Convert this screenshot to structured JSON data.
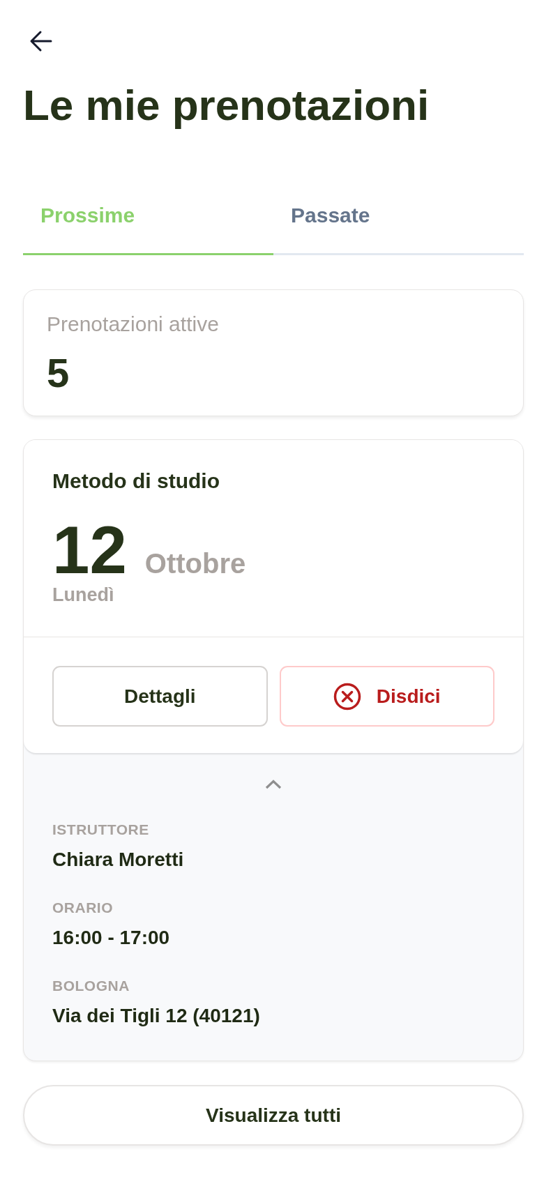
{
  "title": "Le mie prenotazioni",
  "tabs": [
    {
      "label": "Prossime",
      "selected": true
    },
    {
      "label": "Passate",
      "selected": false
    }
  ],
  "summary": {
    "label": "Prenotazioni attive",
    "value": "5"
  },
  "bookings": [
    {
      "course": "Metodo di studio",
      "day": "12",
      "month": "Ottobre",
      "weekday": "Lunedì",
      "actions": [
        {
          "label": "Dettagli",
          "kind": "details"
        },
        {
          "label": "Disdici",
          "kind": "cancel"
        }
      ],
      "expanded": true,
      "details": [
        {
          "label": "ISTRUTTORE",
          "value": "Chiara Moretti"
        },
        {
          "label": "ORARIO",
          "value": "16:00 - 17:00"
        },
        {
          "label": "BOLOGNA",
          "value": "Via dei Tigli 12 (40121)"
        }
      ]
    }
  ],
  "view_all_button": {
    "label": "Visualizza tutti"
  }
}
